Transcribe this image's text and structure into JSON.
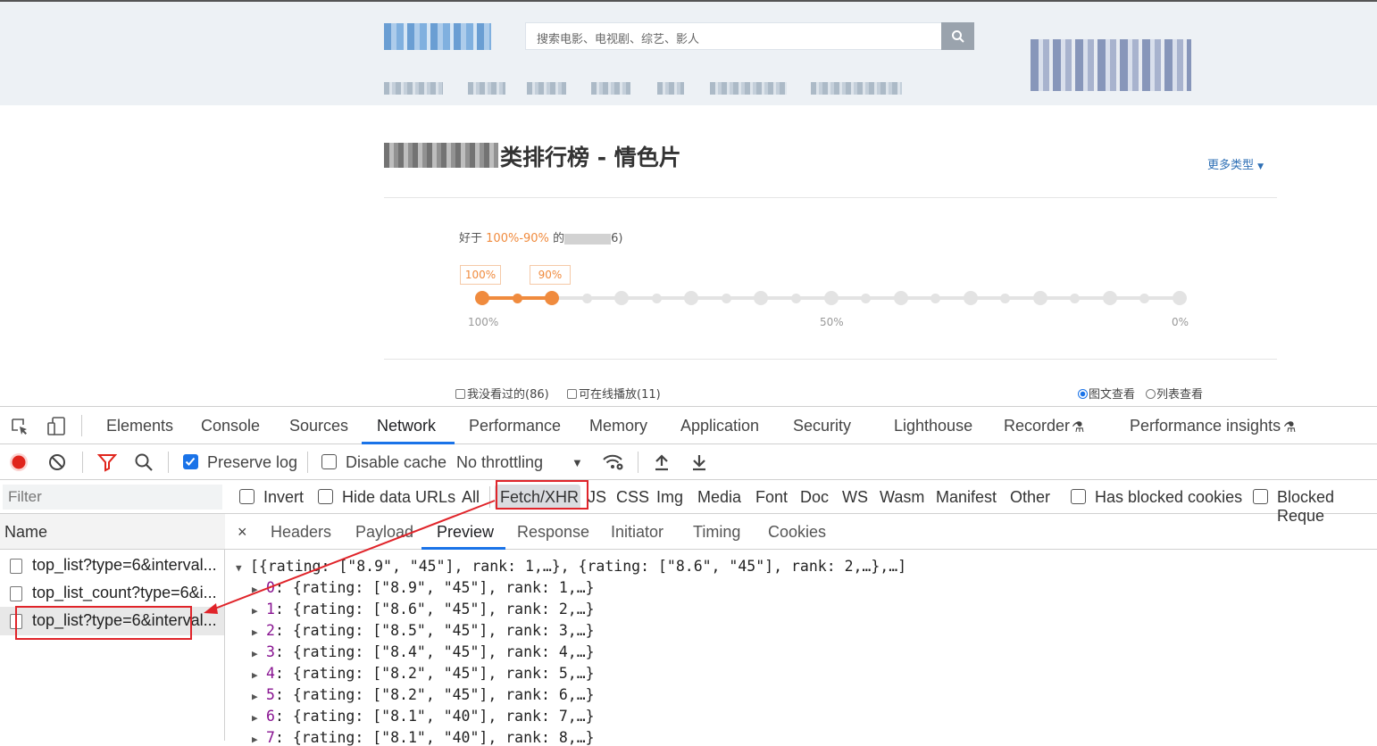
{
  "site": {
    "search_placeholder": "搜索电影、电视剧、综艺、影人",
    "page_title": "类排行榜 - 情色片",
    "more_types": "更多类型",
    "desc_prefix": "好于",
    "desc_range": "100%-90%",
    "desc_mid": "的",
    "desc_suffix": "6)",
    "range_tags": [
      "100%",
      "90%"
    ],
    "scale_labels": [
      "100%",
      "50%",
      "0%"
    ],
    "selected_range": [
      100,
      90
    ],
    "checkbox_unwatched": "我没看过的(86)",
    "checkbox_online": "可在线播放(11)",
    "radio_grid": "图文查看",
    "radio_list": "列表查看",
    "colors": {
      "accent": "#f08b3e",
      "link": "#2e6fb5"
    }
  },
  "devtools": {
    "main_tabs": [
      "Elements",
      "Console",
      "Sources",
      "Network",
      "Performance",
      "Memory",
      "Application",
      "Security",
      "Lighthouse",
      "Recorder",
      "Performance insights"
    ],
    "active_tab": "Network",
    "toolbar": {
      "preserve_log": "Preserve log",
      "preserve_log_checked": true,
      "disable_cache": "Disable cache",
      "throttling": "No throttling"
    },
    "filter": {
      "placeholder": "Filter",
      "invert": "Invert",
      "hide_data_urls": "Hide data URLs",
      "types": [
        "All",
        "Fetch/XHR",
        "JS",
        "CSS",
        "Img",
        "Media",
        "Font",
        "Doc",
        "WS",
        "Wasm",
        "Manifest",
        "Other"
      ],
      "selected_type": "Fetch/XHR",
      "has_blocked_cookies": "Has blocked cookies",
      "blocked_requests": "Blocked Reque"
    },
    "requests": {
      "header": "Name",
      "rows": [
        "top_list?type=6&interval...",
        "top_list_count?type=6&i...",
        "top_list?type=6&interval..."
      ],
      "selected_index": 2
    },
    "detail_tabs": [
      "Headers",
      "Payload",
      "Preview",
      "Response",
      "Initiator",
      "Timing",
      "Cookies"
    ],
    "active_detail_tab": "Preview",
    "close_glyph": "×",
    "preview": {
      "summary": "[{rating: [\"8.9\", \"45\"], rank: 1,…}, {rating: [\"8.6\", \"45\"], rank: 2,…},…]",
      "items": [
        {
          "index": "0",
          "text": "{rating: [\"8.9\", \"45\"], rank: 1,…}"
        },
        {
          "index": "1",
          "text": "{rating: [\"8.6\", \"45\"], rank: 2,…}"
        },
        {
          "index": "2",
          "text": "{rating: [\"8.5\", \"45\"], rank: 3,…}"
        },
        {
          "index": "3",
          "text": "{rating: [\"8.4\", \"45\"], rank: 4,…}"
        },
        {
          "index": "4",
          "text": "{rating: [\"8.2\", \"45\"], rank: 5,…}"
        },
        {
          "index": "5",
          "text": "{rating: [\"8.2\", \"45\"], rank: 6,…}"
        },
        {
          "index": "6",
          "text": "{rating: [\"8.1\", \"40\"], rank: 7,…}"
        },
        {
          "index": "7",
          "text": "{rating: [\"8.1\", \"40\"], rank: 8,…}"
        }
      ]
    }
  }
}
